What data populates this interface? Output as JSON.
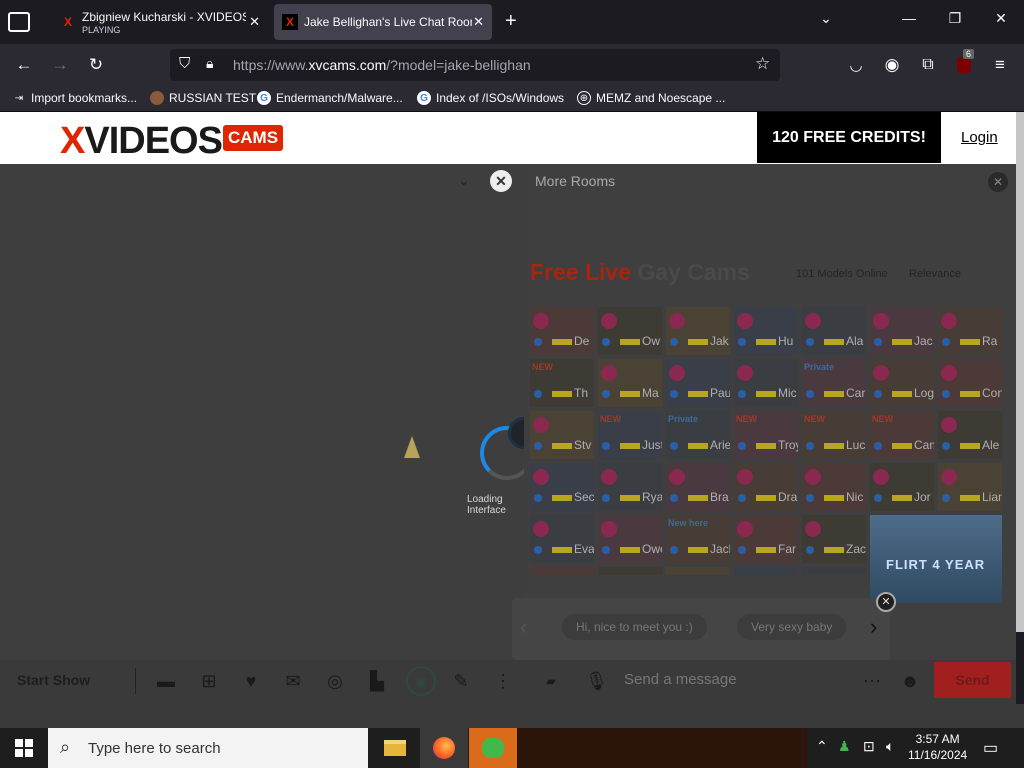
{
  "browser": {
    "tabs": [
      {
        "title": "Zbigniew Kucharski - XVIDEOS.",
        "sub": "PLAYING",
        "active": false
      },
      {
        "title": "Jake Bellighan's Live Chat Room",
        "active": true
      }
    ],
    "url_prefix": "https://www.",
    "url_domain": "xvcams.com",
    "url_path": "/?model=jake-bellighan",
    "extension_badge": "6",
    "bookmarks": [
      "Import bookmarks...",
      "RUSSIAN TEST",
      "Endermanch/Malware...",
      "Index of /ISOs/Windows",
      "MEMZ and Noescape ..."
    ]
  },
  "site": {
    "logo": "VIDEOS",
    "logo_x": "X",
    "logo_cams": "CAMS",
    "credits": "120 FREE CREDITS!",
    "login": "Login"
  },
  "player": {
    "loading": "Loading Interface"
  },
  "rooms": {
    "title": "More Rooms",
    "heading_red": "Free Live",
    "heading_grey": " Gay Cams",
    "models_online": "101 Models Online",
    "sort": "Relevance",
    "tiles": [
      [
        "De",
        "Ow",
        "Jak",
        "Hu",
        "Ala",
        "Jac",
        "Ra"
      ],
      [
        "Th",
        "Ma",
        "Paul Gr",
        "Mic",
        "Car",
        "Log",
        "Connor"
      ],
      [
        "Stv",
        "Justin R",
        "Aries L",
        "Troy Ph",
        "Luca &",
        "Camero",
        "Ale"
      ],
      [
        "Sec",
        "Rya",
        "Bra",
        "Dra",
        "Nic",
        "Jor",
        "Liam R"
      ],
      [
        "Eva",
        "Owen W",
        "Jackso",
        "Far",
        "Zac"
      ]
    ],
    "badges": {
      "new": "NEW",
      "private": "Private",
      "new_here": "New here"
    },
    "promo": "FLIRT 4 YEAR"
  },
  "suggestions": [
    "Hi, nice to meet you :)",
    "Very sexy baby"
  ],
  "toolbar": {
    "start_show": "Start Show",
    "message_placeholder": "Send a message",
    "send": "Send"
  },
  "taskbar": {
    "search_placeholder": "Type here to search",
    "time": "3:57 AM",
    "date": "11/16/2024"
  }
}
